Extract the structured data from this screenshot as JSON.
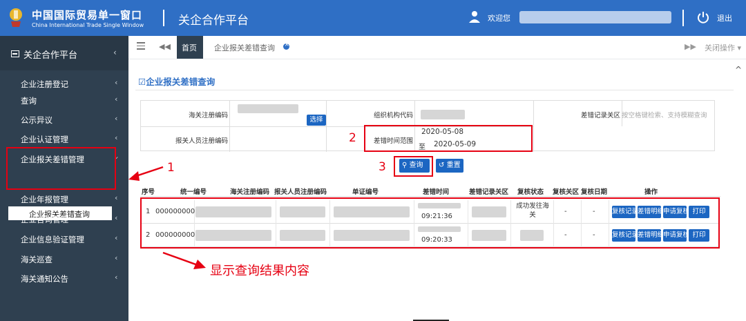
{
  "header": {
    "logo_cn": "中国国际贸易单一窗口",
    "logo_en": "China International Trade Single Window",
    "platform_title": "关企合作平台",
    "welcome": "欢迎您",
    "logout": "退出"
  },
  "sidebar": {
    "title": "关企合作平台",
    "items": [
      {
        "label": "企业注册登记"
      },
      {
        "label": "查询"
      },
      {
        "label": "公示异议"
      },
      {
        "label": "企业认证管理"
      },
      {
        "label": "企业报关差错管理"
      },
      {
        "label": "企业年报管理"
      },
      {
        "label": "企业咨询管理"
      },
      {
        "label": "企业信息验证管理"
      },
      {
        "label": "海关巡查"
      },
      {
        "label": "海关通知公告"
      }
    ],
    "sub_item": "企业报关差错查询"
  },
  "tabs": {
    "home": "首页",
    "current": "企业报关差错查询",
    "close_ops": "关闭操作"
  },
  "panel": {
    "title": "企业报关差错查询"
  },
  "form": {
    "customs_reg_code_label": "海关注册编码",
    "select_button": "选择",
    "org_code_label": "组织机构代码",
    "error_customs_label": "差错记录关区",
    "error_customs_placeholder": "按空格键检索、支持模糊查询",
    "declarant_reg_label": "报关人员注册编码",
    "error_time_label": "差错时间范围",
    "date_from": "2020-05-08",
    "date_to_prefix": "至",
    "date_to": "2020-05-09"
  },
  "actions": {
    "query": "查询",
    "reset": "重置"
  },
  "table": {
    "headers": [
      "序号",
      "统一编号",
      "海关注册编码",
      "报关人员注册编码",
      "单证编号",
      "差错时间",
      "差错记录关区",
      "复核状态",
      "复核关区",
      "复核日期",
      "操作"
    ],
    "rows": [
      {
        "index": "1",
        "unified_no": "000000000",
        "error_time": "09:21:36",
        "review_status": "成功发往海关",
        "review_customs": "-",
        "review_date": "-"
      },
      {
        "index": "2",
        "unified_no": "000000000",
        "error_time": "09:20:33",
        "review_status": "",
        "review_customs": "-",
        "review_date": "-"
      }
    ],
    "ops": [
      "复核记录",
      "差错明细",
      "申请复核",
      "打印"
    ]
  },
  "annotations": {
    "n1": "1",
    "n2": "2",
    "n3": "3",
    "result_note": "显示查询结果内容"
  }
}
